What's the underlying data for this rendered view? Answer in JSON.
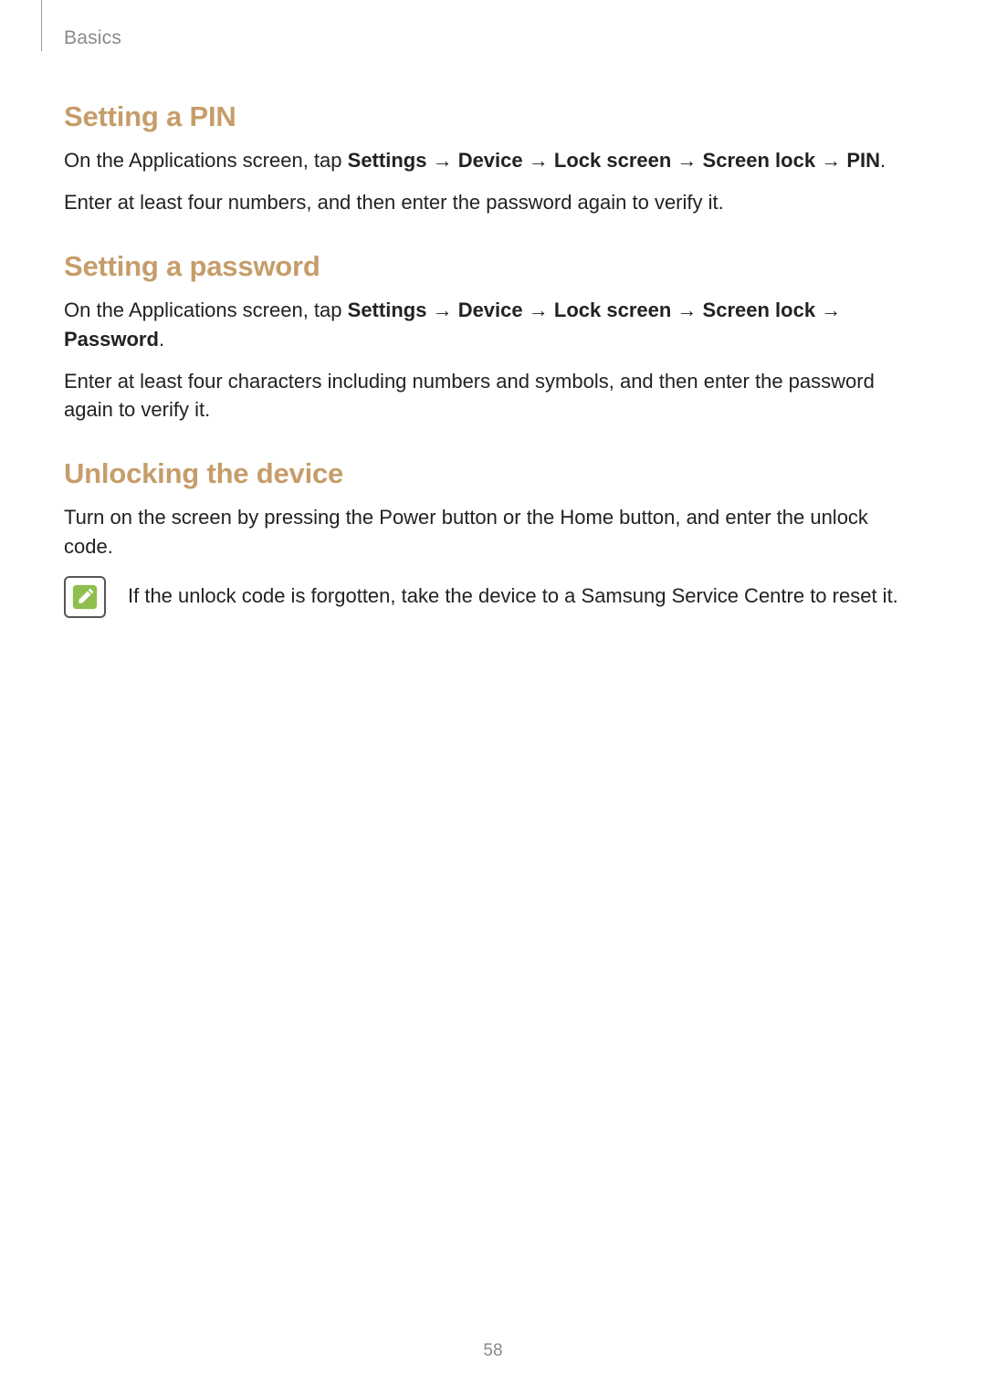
{
  "header": {
    "breadcrumb": "Basics"
  },
  "arrow": "→",
  "sections": {
    "pin": {
      "heading": "Setting a PIN",
      "p1_pre": "On the Applications screen, tap ",
      "path": [
        "Settings",
        "Device",
        "Lock screen",
        "Screen lock",
        "PIN"
      ],
      "p1_post": ".",
      "p2": "Enter at least four numbers, and then enter the password again to verify it."
    },
    "password": {
      "heading": "Setting a password",
      "p1_pre": "On the Applications screen, tap ",
      "path": [
        "Settings",
        "Device",
        "Lock screen",
        "Screen lock",
        "Password"
      ],
      "p1_post": ".",
      "p2": "Enter at least four characters including numbers and symbols, and then enter the password again to verify it."
    },
    "unlock": {
      "heading": "Unlocking the device",
      "p1": "Turn on the screen by pressing the Power button or the Home button, and enter the unlock code.",
      "note": "If the unlock code is forgotten, take the device to a Samsung Service Centre to reset it."
    }
  },
  "page_number": "58"
}
